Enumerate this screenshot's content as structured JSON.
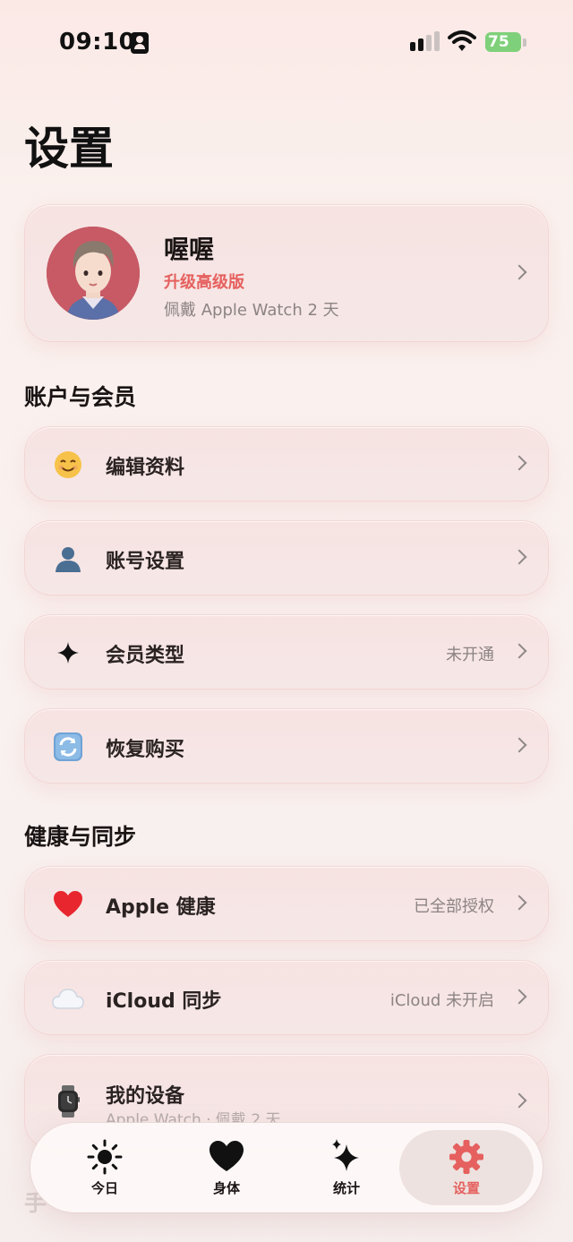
{
  "status_bar": {
    "time": "09:10",
    "battery": "75"
  },
  "page_title": "设置",
  "profile": {
    "name": "喔喔",
    "plan": "升级高级版",
    "subtitle": "佩戴 Apple Watch 2 天"
  },
  "sections": {
    "account": {
      "title": "账户与会员",
      "items": [
        {
          "label": "编辑资料",
          "icon": "smiley-icon",
          "value": ""
        },
        {
          "label": "账号设置",
          "icon": "person-icon",
          "value": ""
        },
        {
          "label": "会员类型",
          "icon": "sparkle-icon",
          "value": "未开通"
        },
        {
          "label": "恢复购买",
          "icon": "restore-icon",
          "value": ""
        }
      ]
    },
    "health": {
      "title": "健康与同步",
      "items": [
        {
          "label": "Apple 健康",
          "icon": "heart-icon",
          "value": "已全部授权"
        },
        {
          "label": "iCloud 同步",
          "icon": "cloud-icon",
          "value": "iCloud 未开启"
        },
        {
          "label": "我的设备",
          "icon": "watch-icon",
          "value": "",
          "sub": "Apple Watch · 佩戴 2 天"
        }
      ]
    },
    "next_title": "手"
  },
  "tab_bar": [
    {
      "label": "今日",
      "icon": "sun-icon",
      "active": false
    },
    {
      "label": "身体",
      "icon": "heart-icon",
      "active": false
    },
    {
      "label": "统计",
      "icon": "sparkles-icon",
      "active": false
    },
    {
      "label": "设置",
      "icon": "gear-icon",
      "active": true
    }
  ],
  "colors": {
    "accent": "#e5605e",
    "battery": "#7fd07a",
    "avatar_bg": "#c75a65"
  }
}
